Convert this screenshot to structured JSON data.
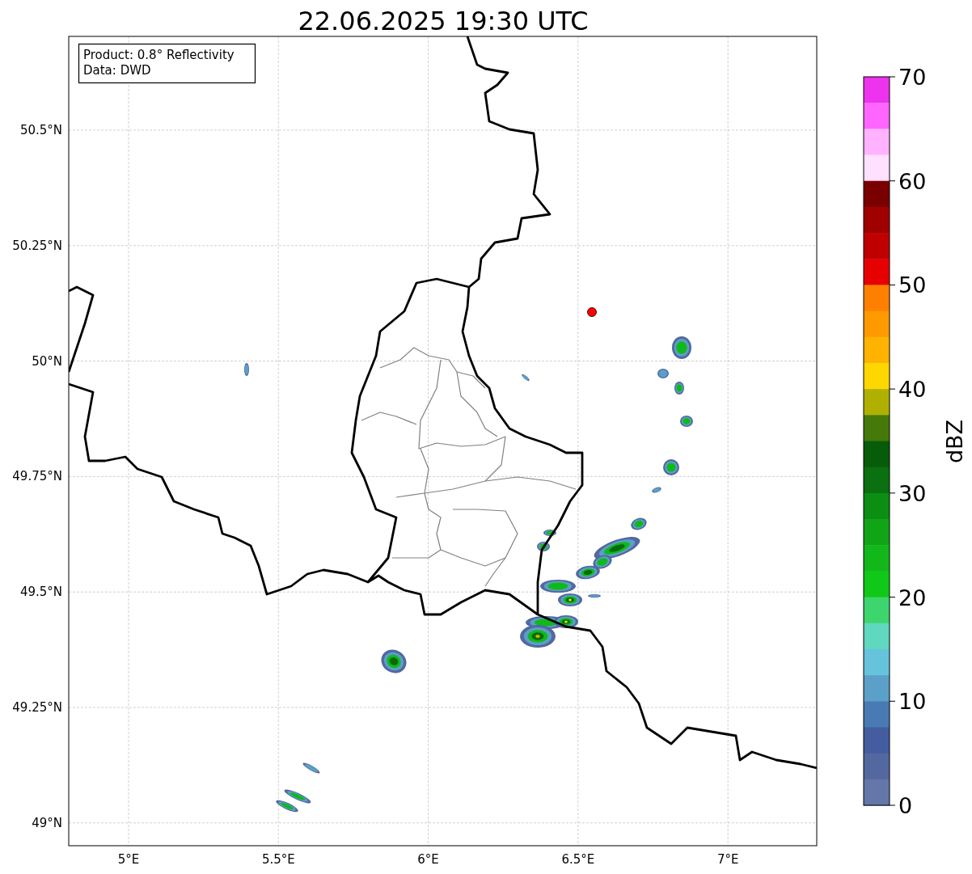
{
  "title": "22.06.2025 19:30 UTC",
  "info_box": {
    "lines": [
      "Product: 0.8° Reflectivity",
      "Data: DWD"
    ]
  },
  "axes": {
    "yticks": [
      "50.5°N",
      "50.25°N",
      "50°N",
      "49.75°N",
      "49.5°N",
      "49.25°N",
      "49°N"
    ],
    "xticks": [
      "5°E",
      "5.5°E",
      "6°E",
      "6.5°E",
      "7°E"
    ]
  },
  "colorbar": {
    "label": "dBZ",
    "ticks": [
      "70",
      "60",
      "50",
      "40",
      "30",
      "20",
      "10",
      "0"
    ],
    "bins": [
      {
        "color": "#ee33ee"
      },
      {
        "color": "#ff66ff"
      },
      {
        "color": "#ffb3ff"
      },
      {
        "color": "#ffe0ff"
      },
      {
        "color": "#7a0000"
      },
      {
        "color": "#a00000"
      },
      {
        "color": "#c00000"
      },
      {
        "color": "#e60000"
      },
      {
        "color": "#ff8000"
      },
      {
        "color": "#ff9900"
      },
      {
        "color": "#ffb300"
      },
      {
        "color": "#ffd700"
      },
      {
        "color": "#b0b000"
      },
      {
        "color": "#457a0a"
      },
      {
        "color": "#065c09"
      },
      {
        "color": "#0a7010"
      },
      {
        "color": "#0c8e12"
      },
      {
        "color": "#10a516"
      },
      {
        "color": "#12b81a"
      },
      {
        "color": "#10c818"
      },
      {
        "color": "#3dd56d"
      },
      {
        "color": "#60d8c0"
      },
      {
        "color": "#66c3dc"
      },
      {
        "color": "#5ba0c8"
      },
      {
        "color": "#4a7ab3"
      },
      {
        "color": "#435da0"
      },
      {
        "color": "#53689f"
      },
      {
        "color": "#6477a8"
      }
    ]
  }
}
